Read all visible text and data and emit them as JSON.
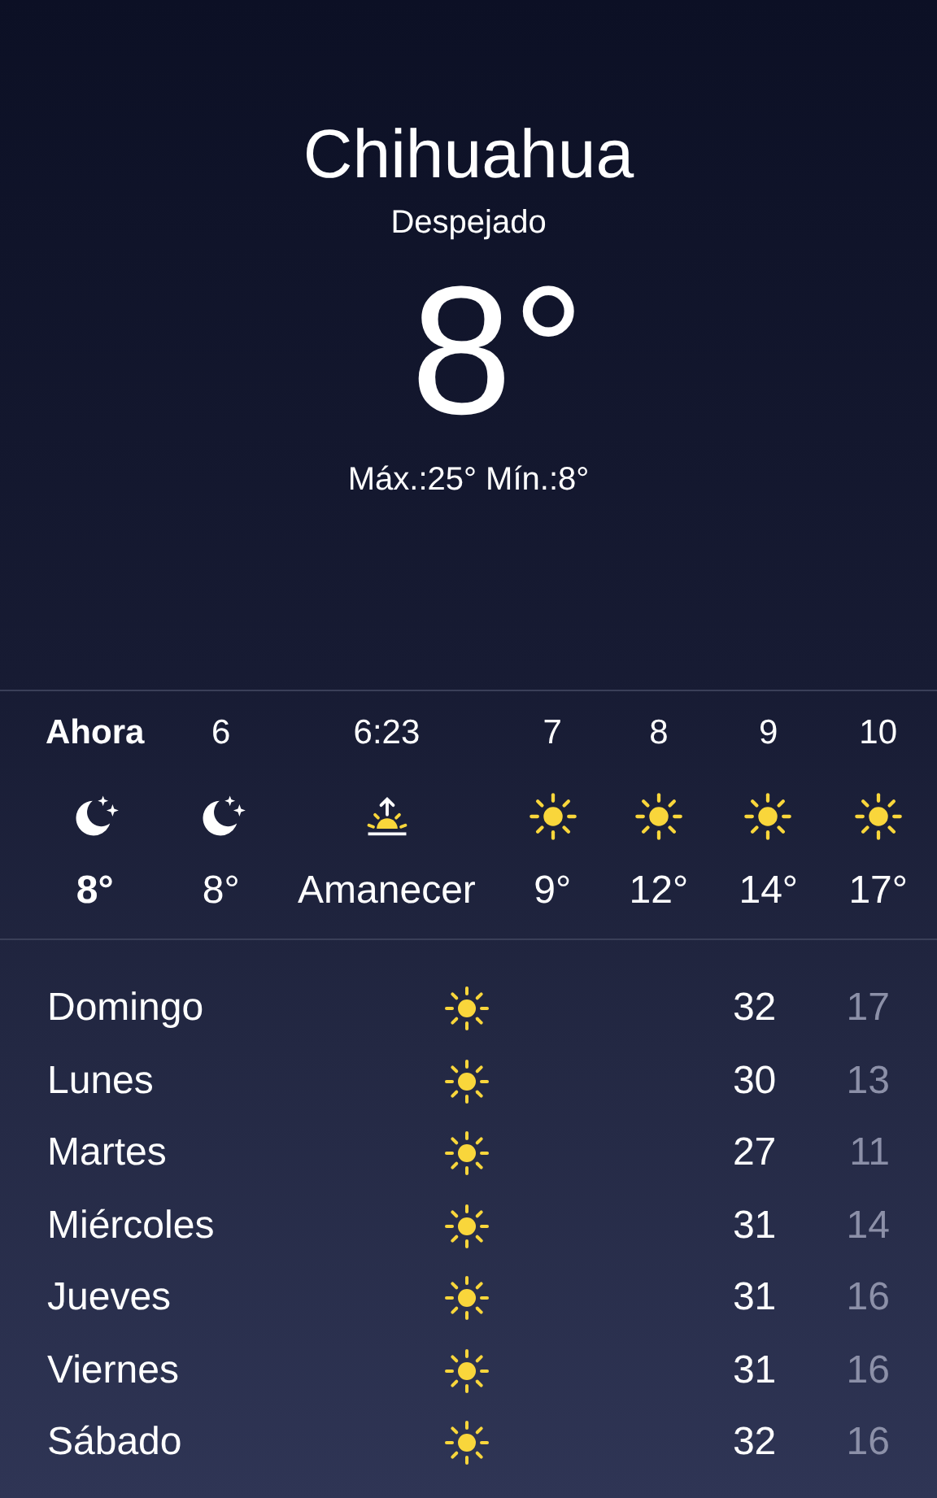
{
  "header": {
    "city": "Chihuahua",
    "condition": "Despejado",
    "temperature": "8°",
    "high_low": "Máx.:25° Mín.:8°"
  },
  "hourly": [
    {
      "time": "Ahora",
      "kind": "moon",
      "temp": "8°",
      "current": true
    },
    {
      "time": "6",
      "kind": "moon",
      "temp": "8°",
      "current": false
    },
    {
      "time": "6:23",
      "kind": "sunrise",
      "temp": "Amanecer",
      "current": false
    },
    {
      "time": "7",
      "kind": "sun",
      "temp": "9°",
      "current": false
    },
    {
      "time": "8",
      "kind": "sun",
      "temp": "12°",
      "current": false
    },
    {
      "time": "9",
      "kind": "sun",
      "temp": "14°",
      "current": false
    },
    {
      "time": "10",
      "kind": "sun",
      "temp": "17°",
      "current": false
    }
  ],
  "daily": [
    {
      "day": "Domingo",
      "kind": "sun",
      "high": "32",
      "low": "17"
    },
    {
      "day": "Lunes",
      "kind": "sun",
      "high": "30",
      "low": "13"
    },
    {
      "day": "Martes",
      "kind": "sun",
      "high": "27",
      "low": "11"
    },
    {
      "day": "Miércoles",
      "kind": "sun",
      "high": "31",
      "low": "14"
    },
    {
      "day": "Jueves",
      "kind": "sun",
      "high": "31",
      "low": "16"
    },
    {
      "day": "Viernes",
      "kind": "sun",
      "high": "31",
      "low": "16"
    },
    {
      "day": "Sábado",
      "kind": "sun",
      "high": "32",
      "low": "16"
    }
  ]
}
